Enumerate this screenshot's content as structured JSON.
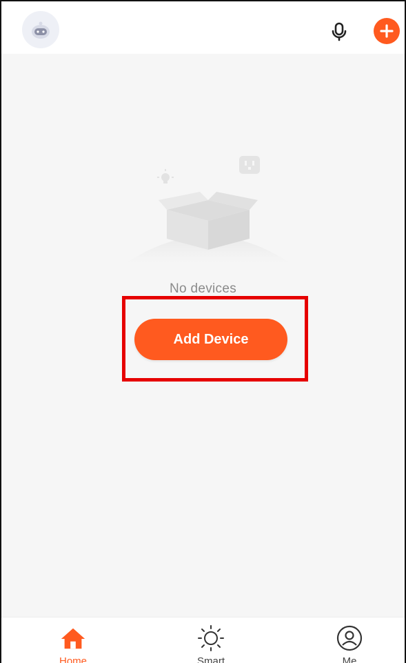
{
  "header": {
    "avatar_icon": "robot-avatar-icon",
    "mic_icon": "microphone-icon",
    "add_icon": "plus-icon"
  },
  "empty_state": {
    "illustration": "empty-box-illustration",
    "message": "No devices",
    "add_button_label": "Add Device"
  },
  "tabs": [
    {
      "label": "Home",
      "icon": "home-icon",
      "active": true
    },
    {
      "label": "Smart",
      "icon": "sun-icon",
      "active": false
    },
    {
      "label": "Me",
      "icon": "user-icon",
      "active": false
    }
  ],
  "colors": {
    "accent": "#ff5a1f",
    "highlight": "#e60000",
    "background": "#f6f6f6"
  }
}
